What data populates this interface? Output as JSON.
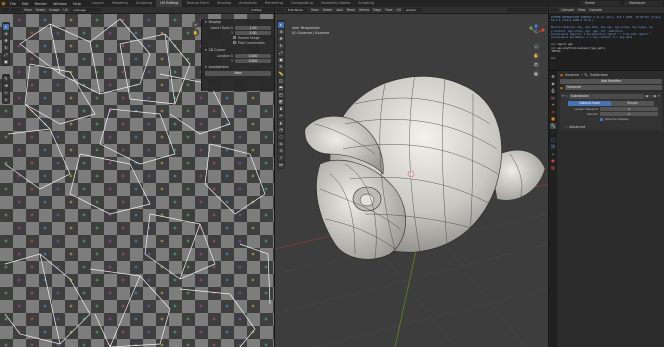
{
  "app": {
    "menus": [
      "File",
      "Edit",
      "Render",
      "Window",
      "Help"
    ],
    "workspace_tabs": [
      "Layout",
      "Modeling",
      "Sculpting",
      "UV Editing",
      "Texture Paint",
      "Shading",
      "Animation",
      "Rendering",
      "Compositing",
      "Geometry Nodes",
      "Scripting"
    ],
    "active_workspace": "UV Editing",
    "scene_name": "Scene",
    "view_layer_name": "ViewLayer"
  },
  "uv_editor": {
    "header": {
      "editor_type": "UV Editor",
      "menus": [
        "View",
        "Select",
        "Image",
        "UV"
      ],
      "image_name": "uvimage",
      "uv_sync": "UVMap"
    },
    "panel": {
      "display_title": "Display",
      "aspect_label": "Aspect Ratio X",
      "aspect_x": "1.00",
      "aspect_y": "1.00",
      "repeat_label": "Repeat Image",
      "pixel_label": "Pixel Coordinates",
      "section_2d_cursor": "2D Cursor",
      "loc_label": "Location X",
      "loc_x": "0.000",
      "loc_y": "0.000",
      "annotations": "Annotations",
      "new_button": "New",
      "tabs": [
        "Image",
        "Tool",
        "View"
      ]
    }
  },
  "viewport": {
    "header": {
      "mode": "Edit Mode",
      "menus": [
        "View",
        "Select",
        "Add",
        "Mesh",
        "Vertex",
        "Edge",
        "Face",
        "UV"
      ],
      "orientation": "Global"
    },
    "overlay_text": {
      "perspective": "User Perspective",
      "object": "(0) Suzanne | Suzanne"
    }
  },
  "console": {
    "header_items": [
      "Console",
      "View",
      "Console"
    ],
    "lines": [
      {
        "text": "PYTHON INTERACTIVE CONSOLE 3.11.11 (main, Feb  7 2025, 15:40:52) [Clang",
        "color": "blue"
      },
      {
        "text": "  19.0.0 (Clang 1900.0.16.0)]",
        "color": "blue"
      },
      {
        "text": "",
        "color": "blue"
      },
      {
        "text": "Builtin Modules:    bpy, bpy.data, bpy.ops, bpy.props, bpy.types, bp",
        "color": "blue"
      },
      {
        "text": "y.context, bpy.utils, bgl, gpu, blf, mathutils",
        "color": "blue"
      },
      {
        "text": "Convenience Imports:   from mathutils import *; from math import *",
        "color": "blue"
      },
      {
        "text": "Convenience Variables: C = bpy.context, D = bpy.data",
        "color": "blue"
      },
      {
        "text": "",
        "color": "blue"
      },
      {
        "text": ">>> import gpu",
        "color": "white"
      },
      {
        "text": ">>> gpu.platform.backend_type_get()",
        "color": "white"
      },
      {
        "text": "'METAL'",
        "color": "white"
      },
      {
        "text": "",
        "color": "white"
      },
      {
        "text": ">>>",
        "color": "white"
      }
    ]
  },
  "properties": {
    "breadcrumb": [
      "Suzanne",
      "Subdivision"
    ],
    "object_name": "Suzanne",
    "add_modifier": "Add Modifier",
    "modifier_name": "Subdivision",
    "modes": [
      "Catmull-Clark",
      "Simple"
    ],
    "active_mode": "Catmull-Clark",
    "fields": [
      {
        "label": "Levels Viewport",
        "value": "1"
      },
      {
        "label": "Render",
        "value": "2"
      }
    ],
    "optimal_display_label": "Optimal Display",
    "advanced": "Advanced"
  },
  "colors": {
    "accent": "#4772b3",
    "blender_orange": "#e87d0d",
    "uv_edge": "#f0f0f0",
    "checker_dark": "#3e3e3e",
    "checker_light": "#7d7d7d",
    "viewport_bg": "#3d3d3d"
  }
}
